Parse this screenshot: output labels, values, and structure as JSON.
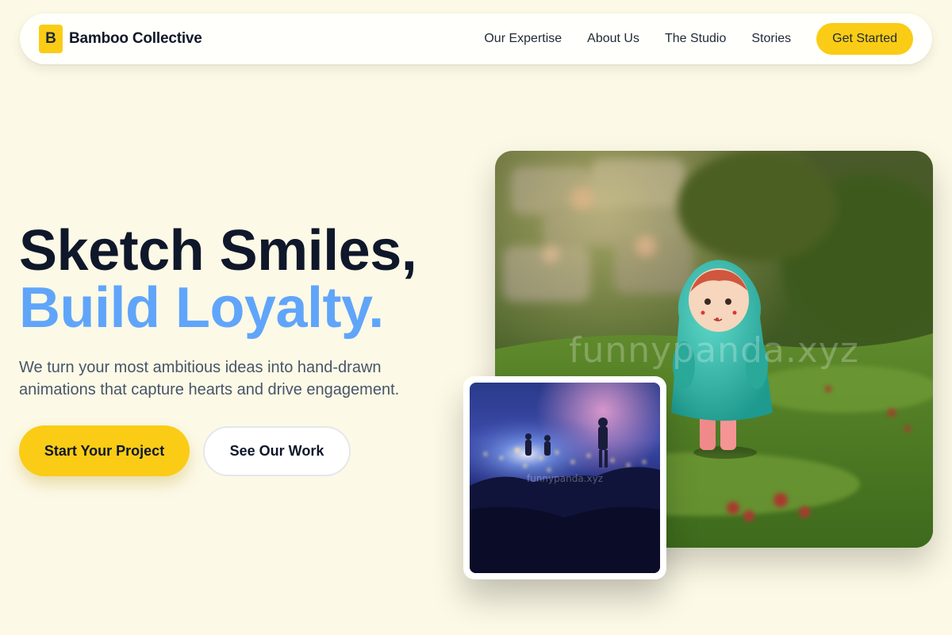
{
  "nav": {
    "logo_letter": "B",
    "brand": "Bamboo Collective",
    "links": [
      "Our Expertise",
      "About Us",
      "The Studio",
      "Stories"
    ],
    "cta": "Get Started"
  },
  "hero": {
    "headline_line1": "Sketch Smiles,",
    "headline_line2": "Build Loyalty.",
    "subtext": "We turn your most ambitious ideas into hand-drawn animations that capture hearts and drive engagement.",
    "primary_button": "Start Your Project",
    "secondary_button": "See Our Work"
  },
  "images": {
    "main_watermark": "funnypanda.xyz",
    "thumb_watermark": "funnypanda.xyz"
  },
  "colors": {
    "background": "#fcf9e6",
    "accent_yellow": "#facc15",
    "accent_blue": "#60a5fa",
    "text_dark": "#0f172a",
    "text_muted": "#475569"
  }
}
